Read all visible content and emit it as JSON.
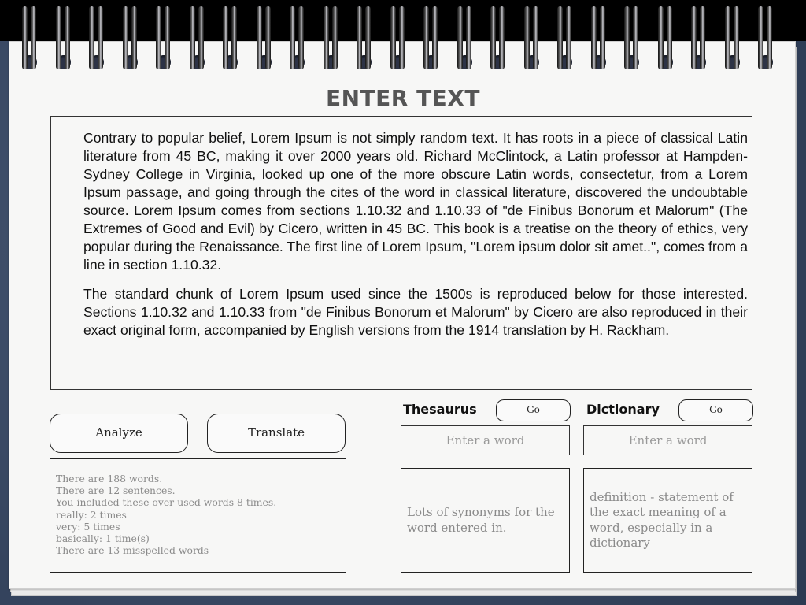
{
  "title": "ENTER TEXT",
  "text": {
    "paragraphs": [
      "Contrary to popular belief, Lorem Ipsum is not simply random text. It has roots in a piece of classical Latin literature from 45 BC, making it over 2000 years old. Richard McClintock, a Latin professor at Hampden-Sydney College in Virginia, looked up one of the more obscure Latin words, consectetur, from a Lorem Ipsum passage, and going through the cites of the word in classical literature, discovered the undoubtable source. Lorem Ipsum comes from sections 1.10.32 and 1.10.33 of \"de Finibus Bonorum et Malorum\" (The Extremes of Good and Evil) by Cicero, written in 45 BC. This book is a treatise on the theory of ethics, very popular during the Renaissance. The first line of Lorem Ipsum, \"Lorem ipsum dolor sit amet..\", comes from a line in section 1.10.32.",
      "The standard chunk of Lorem Ipsum used since the 1500s is reproduced below for those interested. Sections 1.10.32 and 1.10.33 from \"de Finibus Bonorum et Malorum\" by Cicero are also reproduced in their exact original form, accompanied by English versions from the 1914 translation by H. Rackham."
    ]
  },
  "buttons": {
    "analyze": "Analyze",
    "translate": "Translate"
  },
  "analysis": {
    "lines": [
      "There are 188 words.",
      "There are 12 sentences.",
      "You included these over-used words 8 times.",
      "really: 2 times",
      "very: 5 times",
      "basically: 1 time(s)",
      "There are 13 misspelled words"
    ]
  },
  "thesaurus": {
    "label": "Thesaurus",
    "go": "Go",
    "placeholder": "Enter a word",
    "result": "Lots of synonyms for the word entered in."
  },
  "dictionary": {
    "label": "Dictionary",
    "go": "Go",
    "placeholder": "Enter a word",
    "result": "definition - statement of the exact meaning of a word, especially in a dictionary"
  }
}
